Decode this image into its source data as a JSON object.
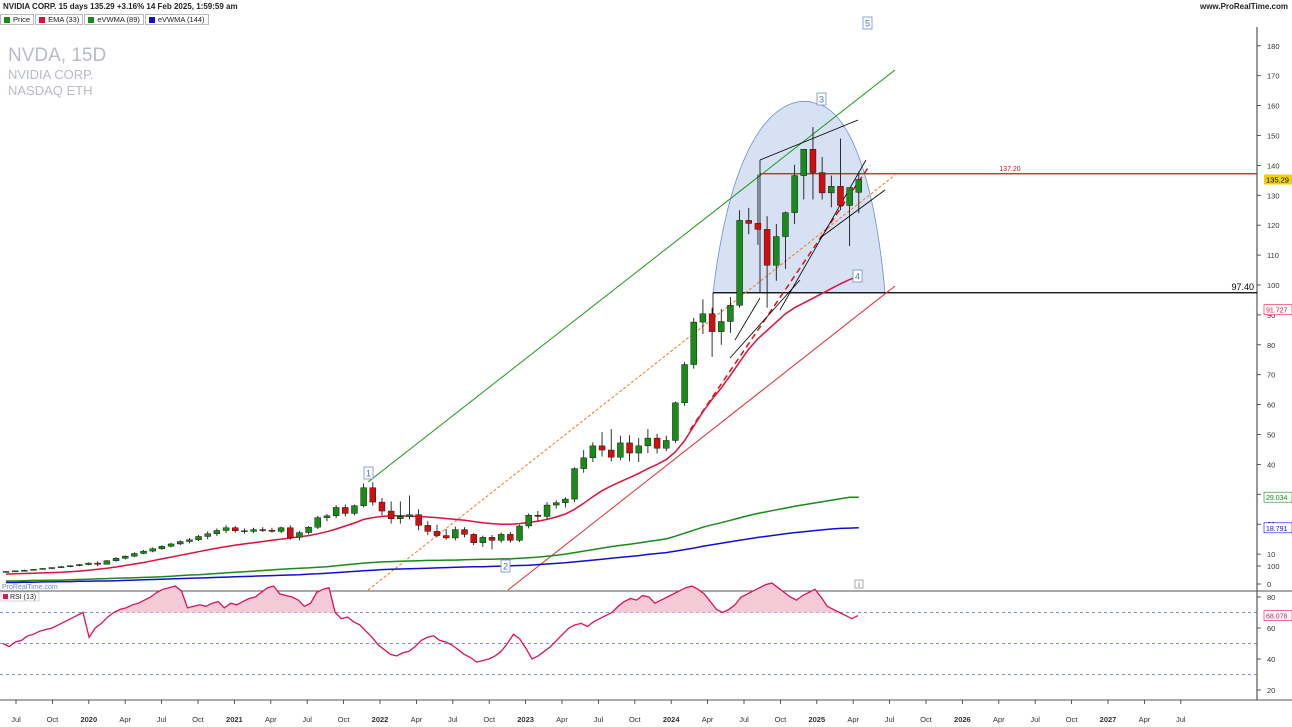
{
  "header": {
    "title": "NVIDIA CORP. 15 days 135.29 +3.16% 14 Feb 2025, 1:59:59 am",
    "brand": "www.ProRealTime.com"
  },
  "legend": [
    {
      "label": "Price",
      "color": "#1a8a1a"
    },
    {
      "label": "EMA (33)",
      "color": "#e0103c"
    },
    {
      "label": "eVWMA (89)",
      "color": "#1a8a1a"
    },
    {
      "label": "eVWMA (144)",
      "color": "#1010d0"
    }
  ],
  "watermark": {
    "ticker": "NVDA, 15D",
    "name": "NVIDIA CORP.",
    "exchange": "NASDAQ ETH"
  },
  "attribution": "ProRealTime.com",
  "rsi_label": "RSI (13)",
  "colors": {
    "up": "#1a8a1a",
    "down": "#d01010",
    "ema": "#e0103c",
    "evwma89": "#1a8a1a",
    "evwma144": "#1010d0",
    "rsi": "#e0105a",
    "cup": "#cfdcf2"
  },
  "chart_data": [
    {
      "type": "candlestick",
      "ylim": [
        0,
        185
      ],
      "yticks": [
        0,
        10,
        20,
        30,
        40,
        50,
        60,
        70,
        80,
        90,
        100,
        110,
        120,
        130,
        140,
        150,
        160,
        170,
        180
      ],
      "xtick_labels": [
        "Jul",
        "Oct",
        "2020",
        "Apr",
        "Jul",
        "Oct",
        "2021",
        "Apr",
        "Jul",
        "Oct",
        "2022",
        "Apr",
        "Jul",
        "Oct",
        "2023",
        "Apr",
        "Jul",
        "Oct",
        "2024",
        "Apr",
        "Jul",
        "Oct",
        "2025",
        "Apr",
        "Jul",
        "Oct",
        "2026",
        "Apr",
        "Jul",
        "Oct",
        "2027",
        "Apr",
        "Jul"
      ],
      "levels": [
        {
          "value": 137.2,
          "label": "137.20",
          "color": "#d01010"
        },
        {
          "value": 97.4,
          "label": "97.40",
          "color": "#000000"
        }
      ],
      "price_tags": [
        {
          "value": 135.29,
          "label": "135.29",
          "bg": "#f0d000"
        },
        {
          "value": 91.727,
          "label": "91.727",
          "color": "#e0103c"
        },
        {
          "value": 29.034,
          "label": "29.034",
          "color": "#1a8a1a"
        },
        {
          "value": 18.791,
          "label": "18.791",
          "color": "#1010d0"
        }
      ],
      "wave_labels": [
        "1",
        "2",
        "3",
        "4",
        "5"
      ],
      "ohlc": [
        [
          4.0,
          4.3,
          3.9,
          4.2
        ],
        [
          4.2,
          4.5,
          4.0,
          4.4
        ],
        [
          4.4,
          4.8,
          4.3,
          4.6
        ],
        [
          4.6,
          5.0,
          4.5,
          4.9
        ],
        [
          4.9,
          5.3,
          4.8,
          5.2
        ],
        [
          5.2,
          5.6,
          5.0,
          5.5
        ],
        [
          5.5,
          6.0,
          5.3,
          5.8
        ],
        [
          5.8,
          6.3,
          5.6,
          6.1
        ],
        [
          6.1,
          6.7,
          5.9,
          6.5
        ],
        [
          6.5,
          7.2,
          6.3,
          7.0
        ],
        [
          7.0,
          7.6,
          6.0,
          6.6
        ],
        [
          6.6,
          8.0,
          6.5,
          7.8
        ],
        [
          7.8,
          9.0,
          7.5,
          8.6
        ],
        [
          8.6,
          9.6,
          8.2,
          9.3
        ],
        [
          9.3,
          10.6,
          9.0,
          10.2
        ],
        [
          10.2,
          11.4,
          10.0,
          11.0
        ],
        [
          11.0,
          12.2,
          10.6,
          11.8
        ],
        [
          11.8,
          13.0,
          11.4,
          12.6
        ],
        [
          12.6,
          13.8,
          12.2,
          13.4
        ],
        [
          13.4,
          14.6,
          13.0,
          14.2
        ],
        [
          14.2,
          15.4,
          13.6,
          14.8
        ],
        [
          14.8,
          16.4,
          14.4,
          15.9
        ],
        [
          15.9,
          17.6,
          15.0,
          16.8
        ],
        [
          16.8,
          18.6,
          16.0,
          17.9
        ],
        [
          17.9,
          19.6,
          17.0,
          18.8
        ],
        [
          18.8,
          19.4,
          17.2,
          17.8
        ],
        [
          17.8,
          18.6,
          16.8,
          17.6
        ],
        [
          17.6,
          18.8,
          17.0,
          18.2
        ],
        [
          18.2,
          19.0,
          17.4,
          18.0
        ],
        [
          18.0,
          18.8,
          17.2,
          17.6
        ],
        [
          17.6,
          19.2,
          17.0,
          18.8
        ],
        [
          18.8,
          19.6,
          14.8,
          15.6
        ],
        [
          15.6,
          17.8,
          14.6,
          17.2
        ],
        [
          17.2,
          19.4,
          16.6,
          19.0
        ],
        [
          19.0,
          22.8,
          18.4,
          22.2
        ],
        [
          22.2,
          23.4,
          21.0,
          22.8
        ],
        [
          22.8,
          26.4,
          22.0,
          25.6
        ],
        [
          25.6,
          26.6,
          22.6,
          23.6
        ],
        [
          23.6,
          26.6,
          23.0,
          26.2
        ],
        [
          26.2,
          33.6,
          25.6,
          32.2
        ],
        [
          32.2,
          34.0,
          26.2,
          27.4
        ],
        [
          27.4,
          28.8,
          23.0,
          24.4
        ],
        [
          24.4,
          27.6,
          20.2,
          21.8
        ],
        [
          21.8,
          27.6,
          20.2,
          22.6
        ],
        [
          22.6,
          29.6,
          21.6,
          23.2
        ],
        [
          23.2,
          25.0,
          18.0,
          19.6
        ],
        [
          19.6,
          21.0,
          16.4,
          17.6
        ],
        [
          17.6,
          19.8,
          15.6,
          16.2
        ],
        [
          16.2,
          18.4,
          14.8,
          15.4
        ],
        [
          15.4,
          19.2,
          14.6,
          18.2
        ],
        [
          18.2,
          19.0,
          15.6,
          16.6
        ],
        [
          16.6,
          17.0,
          13.0,
          13.8
        ],
        [
          13.8,
          16.2,
          12.4,
          15.6
        ],
        [
          15.6,
          16.4,
          11.6,
          14.6
        ],
        [
          14.6,
          17.2,
          13.8,
          16.6
        ],
        [
          16.6,
          17.4,
          13.8,
          14.6
        ],
        [
          14.6,
          19.8,
          14.0,
          19.4
        ],
        [
          19.4,
          23.6,
          18.6,
          23.0
        ],
        [
          23.0,
          24.4,
          21.0,
          22.6
        ],
        [
          22.6,
          27.4,
          21.8,
          26.4
        ],
        [
          26.4,
          28.0,
          25.2,
          27.2
        ],
        [
          27.2,
          29.0,
          25.6,
          28.4
        ],
        [
          28.4,
          39.0,
          27.4,
          38.6
        ],
        [
          38.6,
          44.8,
          37.2,
          42.2
        ],
        [
          42.2,
          47.4,
          40.8,
          46.2
        ],
        [
          46.2,
          50.8,
          42.6,
          44.8
        ],
        [
          44.8,
          51.8,
          41.0,
          42.4
        ],
        [
          42.4,
          49.6,
          41.4,
          47.2
        ],
        [
          47.2,
          49.8,
          41.0,
          43.8
        ],
        [
          43.8,
          48.8,
          40.8,
          46.2
        ],
        [
          46.2,
          51.8,
          43.8,
          48.8
        ],
        [
          48.8,
          50.2,
          43.6,
          45.4
        ],
        [
          45.4,
          49.6,
          44.4,
          48.0
        ],
        [
          48.0,
          61.0,
          47.2,
          60.6
        ],
        [
          60.6,
          74.2,
          59.6,
          73.4
        ],
        [
          73.4,
          89.0,
          72.0,
          87.6
        ],
        [
          87.6,
          95.2,
          83.6,
          90.4
        ],
        [
          90.4,
          92.4,
          76.0,
          84.4
        ],
        [
          84.4,
          92.0,
          80.0,
          87.8
        ],
        [
          87.8,
          96.0,
          84.0,
          93.2
        ],
        [
          93.2,
          125.0,
          92.4,
          121.6
        ],
        [
          121.6,
          125.8,
          117.0,
          120.6
        ],
        [
          120.6,
          137.0,
          113.4,
          118.6
        ],
        [
          118.6,
          123.0,
          92.4,
          106.6
        ],
        [
          106.6,
          120.4,
          101.4,
          116.2
        ],
        [
          116.2,
          124.6,
          105.4,
          124.2
        ],
        [
          124.2,
          140.2,
          120.4,
          136.6
        ],
        [
          136.6,
          144.4,
          128.6,
          145.4
        ],
        [
          145.4,
          152.8,
          128.6,
          137.6
        ],
        [
          137.6,
          142.8,
          128.6,
          130.8
        ],
        [
          130.8,
          136.6,
          126.0,
          133.0
        ],
        [
          133.0,
          149.0,
          125.0,
          126.6
        ],
        [
          126.6,
          130.6,
          113.0,
          132.6
        ],
        [
          131.0,
          138.0,
          124.0,
          135.3
        ]
      ],
      "series": [
        {
          "name": "EMA (33)",
          "values": [
            3.3,
            3.4,
            3.5,
            3.6,
            3.7,
            3.8,
            3.9,
            4.1,
            4.3,
            4.6,
            4.9,
            5.3,
            5.7,
            6.2,
            6.7,
            7.2,
            7.8,
            8.4,
            9.0,
            9.6,
            10.2,
            10.8,
            11.4,
            12.0,
            12.5,
            13.0,
            13.4,
            13.8,
            14.2,
            14.6,
            15.0,
            15.4,
            15.8,
            16.2,
            16.8,
            17.5,
            18.4,
            19.4,
            20.4,
            21.6,
            22.2,
            22.6,
            22.8,
            22.8,
            22.7,
            22.6,
            22.4,
            22.2,
            21.9,
            21.6,
            21.3,
            20.9,
            20.5,
            20.2,
            20.0,
            20.0,
            20.2,
            20.6,
            21.0,
            21.6,
            22.4,
            23.4,
            25.0,
            27.0,
            29.2,
            31.2,
            32.8,
            34.2,
            35.6,
            37.0,
            38.6,
            40.0,
            41.6,
            44.2,
            48.0,
            52.8,
            57.6,
            61.8,
            65.6,
            69.8,
            74.2,
            78.6,
            82.0,
            84.8,
            87.6,
            90.4,
            92.4,
            94.0,
            95.6,
            97.2,
            98.8,
            100.4,
            101.8,
            103.0
          ]
        },
        {
          "name": "eVWMA (89)",
          "values": [
            1.0,
            1.0,
            1.1,
            1.2,
            1.2,
            1.3,
            1.3,
            1.4,
            1.5,
            1.6,
            1.7,
            1.8,
            1.9,
            2.0,
            2.1,
            2.2,
            2.3,
            2.4,
            2.6,
            2.8,
            3.0,
            3.1,
            3.3,
            3.5,
            3.7,
            3.9,
            4.1,
            4.3,
            4.5,
            4.7,
            4.9,
            5.1,
            5.3,
            5.4,
            5.6,
            5.8,
            6.1,
            6.4,
            6.7,
            7.0,
            7.2,
            7.4,
            7.5,
            7.6,
            7.7,
            7.8,
            7.9,
            7.9,
            8.0,
            8.0,
            8.1,
            8.2,
            8.3,
            8.3,
            8.4,
            8.4,
            8.6,
            8.8,
            9.0,
            9.3,
            9.6,
            10.0,
            10.5,
            11.0,
            11.5,
            12.0,
            12.5,
            12.9,
            13.3,
            13.7,
            14.2,
            14.6,
            15.1,
            16.0,
            17.0,
            18.0,
            19.0,
            19.8,
            20.5,
            21.3,
            22.1,
            22.9,
            23.6,
            24.2,
            24.8,
            25.4,
            26.0,
            26.5,
            27.0,
            27.5,
            28.0,
            28.5,
            29.0,
            29.034
          ]
        },
        {
          "name": "eVWMA (144)",
          "values": [
            0.5,
            0.5,
            0.6,
            0.6,
            0.7,
            0.7,
            0.8,
            0.8,
            0.9,
            0.9,
            1.0,
            1.0,
            1.1,
            1.2,
            1.3,
            1.4,
            1.5,
            1.6,
            1.7,
            1.8,
            1.9,
            2.0,
            2.1,
            2.2,
            2.3,
            2.4,
            2.5,
            2.6,
            2.7,
            2.8,
            2.9,
            3.0,
            3.1,
            3.3,
            3.4,
            3.6,
            3.8,
            4.0,
            4.2,
            4.4,
            4.6,
            4.8,
            4.9,
            5.0,
            5.1,
            5.2,
            5.3,
            5.4,
            5.5,
            5.6,
            5.7,
            5.8,
            5.8,
            5.9,
            6.0,
            6.1,
            6.2,
            6.3,
            6.5,
            6.7,
            6.9,
            7.1,
            7.4,
            7.7,
            8.0,
            8.3,
            8.6,
            8.9,
            9.2,
            9.5,
            9.9,
            10.2,
            10.5,
            11.0,
            11.5,
            12.0,
            12.6,
            13.1,
            13.6,
            14.1,
            14.6,
            15.1,
            15.6,
            16.0,
            16.4,
            16.8,
            17.2,
            17.5,
            17.8,
            18.1,
            18.4,
            18.6,
            18.7,
            18.791
          ]
        }
      ]
    },
    {
      "type": "line",
      "title": "RSI (13)",
      "ylim": [
        15,
        110
      ],
      "yticks": [
        20,
        40,
        60,
        80,
        100
      ],
      "levels": [
        70,
        50,
        30
      ],
      "last_value": "68.078",
      "values": [
        50,
        48,
        51,
        52,
        55,
        56,
        58,
        59,
        60,
        62,
        64,
        66,
        68,
        70,
        54,
        60,
        63,
        67,
        70,
        72,
        73,
        75,
        76,
        78,
        80,
        83,
        85,
        86,
        87,
        84,
        73,
        74,
        75,
        74,
        76,
        77,
        73,
        76,
        75,
        77,
        79,
        80,
        83,
        86,
        87,
        82,
        81,
        80,
        78,
        74,
        76,
        83,
        85,
        86,
        70,
        66,
        67,
        64,
        62,
        58,
        54,
        49,
        46,
        43,
        42,
        44,
        45,
        48,
        52,
        54,
        55,
        52,
        51,
        49,
        46,
        43,
        41,
        38,
        39,
        40,
        42,
        45,
        50,
        56,
        53,
        47,
        40,
        42,
        45,
        48,
        52,
        56,
        60,
        62,
        63,
        61,
        64,
        66,
        68,
        70,
        74,
        77,
        79,
        78,
        81,
        80,
        76,
        78,
        80,
        82,
        84,
        86,
        87,
        85,
        82,
        77,
        72,
        70,
        72,
        75,
        80,
        82,
        84,
        86,
        88,
        89,
        86,
        83,
        80,
        78,
        81,
        83,
        85,
        80,
        74,
        72,
        70,
        68,
        66,
        68
      ]
    }
  ]
}
